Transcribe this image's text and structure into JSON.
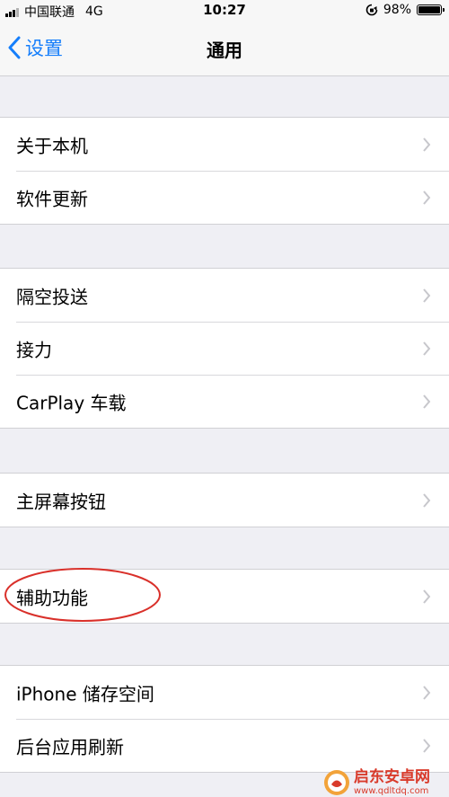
{
  "status_bar": {
    "carrier": "中国联通",
    "network": "4G",
    "time": "10:27",
    "battery_percent": "98%",
    "battery_level": 0.98
  },
  "nav": {
    "back_label": "设置",
    "title": "通用"
  },
  "groups": [
    {
      "items": [
        {
          "label": "关于本机"
        },
        {
          "label": "软件更新"
        }
      ]
    },
    {
      "items": [
        {
          "label": "隔空投送"
        },
        {
          "label": "接力"
        },
        {
          "label": "CarPlay 车载"
        }
      ]
    },
    {
      "items": [
        {
          "label": "主屏幕按钮"
        }
      ]
    },
    {
      "items": [
        {
          "label": "辅助功能"
        }
      ]
    },
    {
      "items": [
        {
          "label": "iPhone 储存空间"
        },
        {
          "label": "后台应用刷新"
        }
      ]
    }
  ],
  "annotation": {
    "color": "#d9302a"
  },
  "watermark": {
    "title": "启东安卓网",
    "url": "www.qdltdq.com"
  },
  "colors": {
    "accent": "#157efb",
    "background": "#efeff4",
    "chevron": "#c7c7cc"
  }
}
